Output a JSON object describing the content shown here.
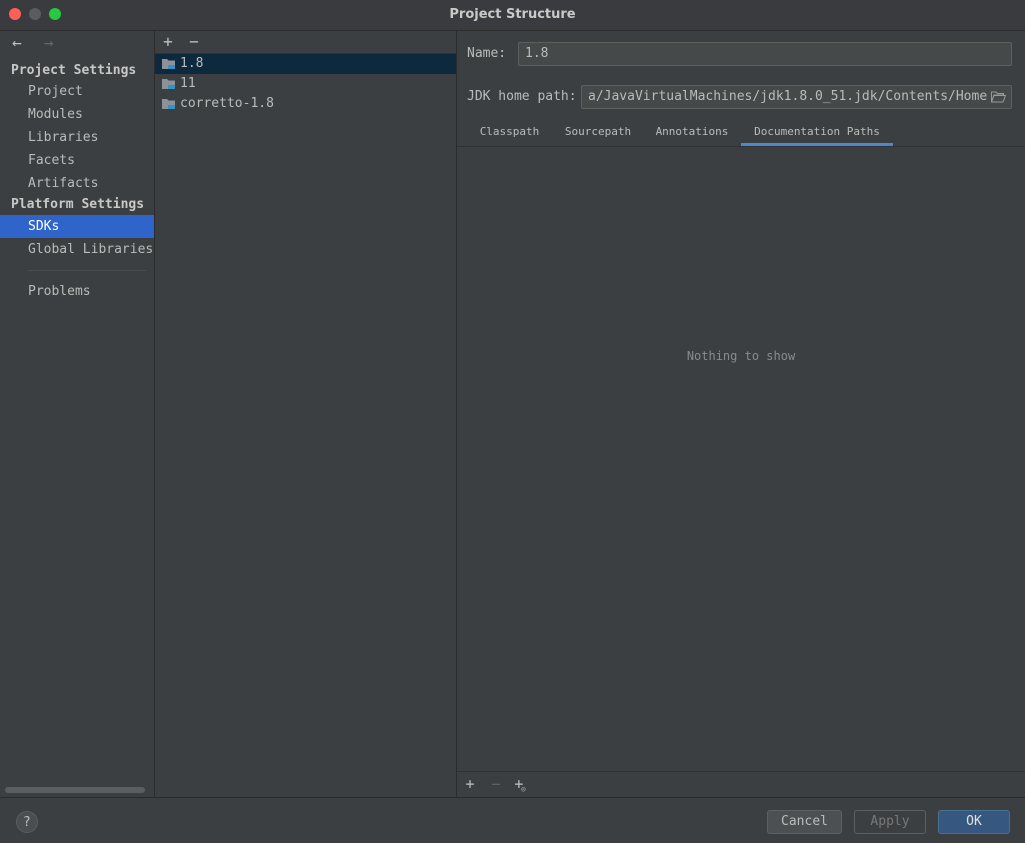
{
  "window": {
    "title": "Project Structure"
  },
  "nav": {
    "back_icon": "arrow-left-icon",
    "forward_icon": "arrow-right-icon",
    "project_settings_header": "Project Settings",
    "project_settings_items": [
      "Project",
      "Modules",
      "Libraries",
      "Facets",
      "Artifacts"
    ],
    "platform_settings_header": "Platform Settings",
    "platform_settings_items": [
      "SDKs",
      "Global Libraries"
    ],
    "selected": "SDKs",
    "problems": "Problems"
  },
  "sdk_list": {
    "add_label": "+",
    "remove_label": "−",
    "items": [
      "1.8",
      "11",
      "corretto-1.8"
    ],
    "selected": "1.8"
  },
  "detail": {
    "name_label": "Name:",
    "name_value": "1.8",
    "jdk_home_label": "JDK home path:",
    "jdk_home_value": "a/JavaVirtualMachines/jdk1.8.0_51.jdk/Contents/Home",
    "tabs": [
      "Classpath",
      "Sourcepath",
      "Annotations",
      "Documentation Paths"
    ],
    "active_tab": "Documentation Paths",
    "empty_text": "Nothing to show",
    "bottom_add": "+",
    "bottom_remove": "−",
    "bottom_add_url": "+"
  },
  "footer": {
    "help_label": "?",
    "cancel_label": "Cancel",
    "apply_label": "Apply",
    "ok_label": "OK"
  },
  "colors": {
    "selection": "#2f65ca",
    "list_selection": "#0d293e",
    "tab_accent": "#4a88c7",
    "ok_button": "#365880"
  }
}
